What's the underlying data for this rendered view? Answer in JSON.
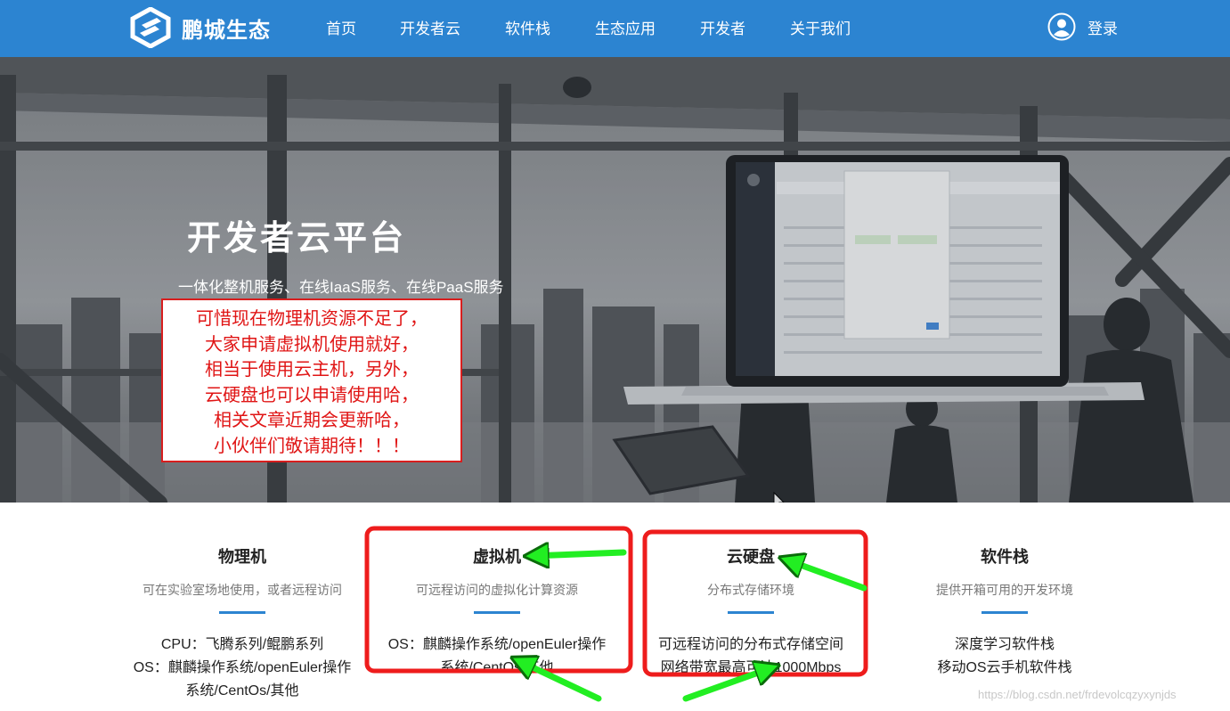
{
  "header": {
    "brand": "鹏城生态",
    "nav": [
      {
        "label": "首页"
      },
      {
        "label": "开发者云"
      },
      {
        "label": "软件栈"
      },
      {
        "label": "生态应用"
      },
      {
        "label": "开发者"
      },
      {
        "label": "关于我们"
      }
    ],
    "login_label": "登录"
  },
  "hero": {
    "title": "开发者云平台",
    "subtitle": "一体化整机服务、在线IaaS服务、在线PaaS服务",
    "annotation_lines": [
      "可惜现在物理机资源不足了，",
      "大家申请虚拟机使用就好，",
      "相当于使用云主机，另外，",
      "云硬盘也可以申请使用哈，",
      "相关文章近期会更新哈，",
      "小伙伴们敬请期待！！！"
    ]
  },
  "features": [
    {
      "title": "物理机",
      "subtitle": "可在实验室场地使用，或者远程访问",
      "lines": [
        "CPU：飞腾系列/鲲鹏系列",
        "OS：麒麟操作系统/openEuler操作",
        "系统/CentOs/其他"
      ]
    },
    {
      "title": "虚拟机",
      "subtitle": "可远程访问的虚拟化计算资源",
      "lines": [
        "OS：麒麟操作系统/openEuler操作",
        "系统/CentOs/其他"
      ]
    },
    {
      "title": "云硬盘",
      "subtitle": "分布式存储环境",
      "lines": [
        "可远程访问的分布式存储空间",
        "网络带宽最高可达1000Mbps"
      ]
    },
    {
      "title": "软件栈",
      "subtitle": "提供开箱可用的开发环境",
      "lines": [
        "深度学习软件栈",
        "移动OS云手机软件栈"
      ]
    }
  ],
  "watermark": "https://blog.csdn.net/frdevolcqzyxynjds",
  "colors": {
    "header_bg": "#2c84d1",
    "annotation_red": "#e01515",
    "arrow_green": "#22ee22",
    "accent_bar": "#2c84d1"
  }
}
